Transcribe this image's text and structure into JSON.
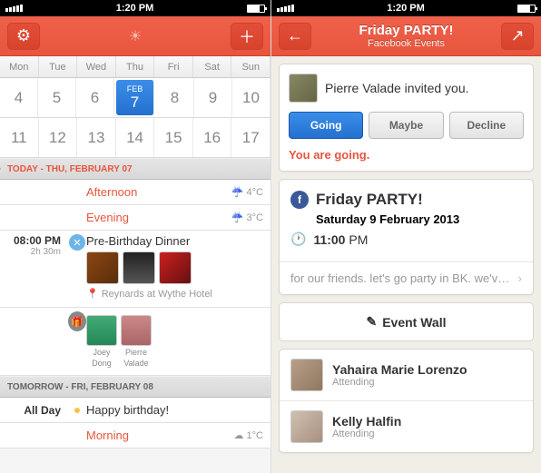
{
  "status": {
    "time": "1:20 PM"
  },
  "left": {
    "weekdays": [
      "Mon",
      "Tue",
      "Wed",
      "Thu",
      "Fri",
      "Sat",
      "Sun"
    ],
    "row1": [
      "4",
      "5",
      "6",
      "7",
      "8",
      "9",
      "10"
    ],
    "row2": [
      "11",
      "12",
      "13",
      "14",
      "15",
      "16",
      "17"
    ],
    "selMonth": "Feb",
    "todayHdr": "TODAY - THU, FEBRUARY 07",
    "afternoon": "Afternoon",
    "afternoonTemp": "4°C",
    "evening": "Evening",
    "eveningTemp": "3°C",
    "event1": {
      "time": "08:00 PM",
      "dur": "2h 30m",
      "title": "Pre-Birthday Dinner",
      "loc": "Reynards at Wythe Hotel"
    },
    "people": [
      {
        "n1": "Joey",
        "n2": "Dong"
      },
      {
        "n1": "Pierre",
        "n2": "Valade"
      }
    ],
    "tomHdr": "TOMORROW - FRI, FEBRUARY 08",
    "allday": "All Day",
    "bday": "Happy birthday!",
    "morning": "Morning",
    "morningTemp": "1°C"
  },
  "right": {
    "title": "Friday PARTY!",
    "subtitle": "Facebook Events",
    "inviter": "Pierre Valade invited you.",
    "btns": {
      "going": "Going",
      "maybe": "Maybe",
      "decline": "Decline"
    },
    "status": "You are going.",
    "eventTitle": "Friday PARTY!",
    "eventDate": "Saturday 9 February 2013",
    "eventTime": "11:00",
    "eventAmPm": "PM",
    "desc": "for our friends. let's go party in BK. we'v…",
    "wall": "Event Wall",
    "att": [
      {
        "name": "Yahaira Marie Lorenzo",
        "s": "Attending"
      },
      {
        "name": "Kelly Halfin",
        "s": "Attending"
      }
    ]
  }
}
